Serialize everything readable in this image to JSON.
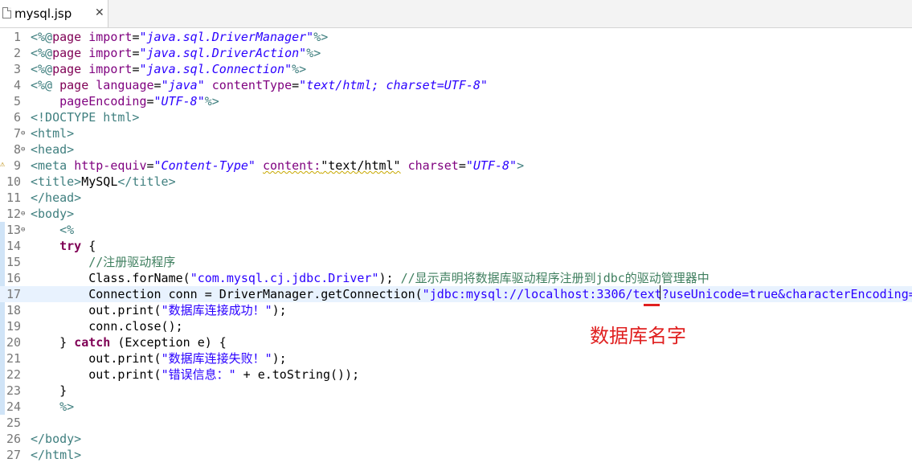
{
  "tab": {
    "label": "mysql.jsp",
    "close": "✕",
    "icon": "jsp-file-icon"
  },
  "annotation": {
    "text": "数据库名字",
    "color": "#e02020"
  },
  "colors": {
    "tag": "#3f7f7f",
    "keyword": "#7f0055",
    "string": "#2a00ff",
    "comment": "#3f7f5f",
    "attribute": "#7f007f",
    "current_line": "#e8f2fe"
  },
  "lines": [
    {
      "n": "1",
      "fold": false,
      "warn": false,
      "current": false,
      "tokens": [
        [
          "tag",
          "<%@"
        ],
        [
          "dir",
          "page"
        ],
        [
          "plain",
          " "
        ],
        [
          "attr",
          "import"
        ],
        [
          "plain",
          "="
        ],
        [
          "str",
          "\"java.sql.DriverManager\""
        ],
        [
          "tag",
          "%>"
        ]
      ]
    },
    {
      "n": "2",
      "fold": false,
      "warn": false,
      "current": false,
      "tokens": [
        [
          "tag",
          "<%@"
        ],
        [
          "dir",
          "page"
        ],
        [
          "plain",
          " "
        ],
        [
          "attr",
          "import"
        ],
        [
          "plain",
          "="
        ],
        [
          "str",
          "\"java.sql.DriverAction\""
        ],
        [
          "tag",
          "%>"
        ]
      ]
    },
    {
      "n": "3",
      "fold": false,
      "warn": false,
      "current": false,
      "tokens": [
        [
          "tag",
          "<%@"
        ],
        [
          "dir",
          "page"
        ],
        [
          "plain",
          " "
        ],
        [
          "attr",
          "import"
        ],
        [
          "plain",
          "="
        ],
        [
          "str",
          "\"java.sql.Connection\""
        ],
        [
          "tag",
          "%>"
        ]
      ]
    },
    {
      "n": "4",
      "fold": false,
      "warn": false,
      "current": false,
      "tokens": [
        [
          "tag",
          "<%@"
        ],
        [
          "plain",
          " "
        ],
        [
          "dir",
          "page"
        ],
        [
          "plain",
          " "
        ],
        [
          "attr",
          "language"
        ],
        [
          "plain",
          "="
        ],
        [
          "str",
          "\"java\""
        ],
        [
          "plain",
          " "
        ],
        [
          "attr",
          "contentType"
        ],
        [
          "plain",
          "="
        ],
        [
          "str",
          "\"text/html; charset=UTF-8\""
        ]
      ]
    },
    {
      "n": "5",
      "fold": false,
      "warn": false,
      "current": false,
      "tokens": [
        [
          "plain",
          "    "
        ],
        [
          "attr",
          "pageEncoding"
        ],
        [
          "plain",
          "="
        ],
        [
          "str",
          "\"UTF-8\""
        ],
        [
          "tag",
          "%>"
        ]
      ]
    },
    {
      "n": "6",
      "fold": false,
      "warn": false,
      "current": false,
      "tokens": [
        [
          "tag",
          "<!DOCTYPE html>"
        ]
      ]
    },
    {
      "n": "7",
      "fold": true,
      "warn": false,
      "current": false,
      "tokens": [
        [
          "tag",
          "<html>"
        ]
      ]
    },
    {
      "n": "8",
      "fold": true,
      "warn": false,
      "current": false,
      "tokens": [
        [
          "tag",
          "<head>"
        ]
      ]
    },
    {
      "n": "9",
      "fold": false,
      "warn": true,
      "current": false,
      "tokens": [
        [
          "tag",
          "<meta"
        ],
        [
          "plain",
          " "
        ],
        [
          "attr",
          "http-equiv"
        ],
        [
          "plain",
          "="
        ],
        [
          "str",
          "\"Content-Type\""
        ],
        [
          "plain",
          " "
        ],
        [
          "attrsq",
          "content:"
        ],
        [
          "plainsq",
          "\"text/html\""
        ],
        [
          "plain",
          " "
        ],
        [
          "attr",
          "charset"
        ],
        [
          "plain",
          "="
        ],
        [
          "str",
          "\"UTF-8\""
        ],
        [
          "tag",
          ">"
        ]
      ]
    },
    {
      "n": "10",
      "fold": false,
      "warn": false,
      "current": false,
      "tokens": [
        [
          "tag",
          "<title>"
        ],
        [
          "plain",
          "MySQL"
        ],
        [
          "tag",
          "</title>"
        ]
      ]
    },
    {
      "n": "11",
      "fold": false,
      "warn": false,
      "current": false,
      "tokens": [
        [
          "tag",
          "</head>"
        ]
      ]
    },
    {
      "n": "12",
      "fold": true,
      "warn": false,
      "current": false,
      "tokens": [
        [
          "tag",
          "<body>"
        ]
      ]
    },
    {
      "n": "13",
      "fold": true,
      "warn": false,
      "current": false,
      "tokens": [
        [
          "plain",
          "    "
        ],
        [
          "tag",
          "<%"
        ]
      ]
    },
    {
      "n": "14",
      "fold": false,
      "warn": false,
      "current": false,
      "tokens": [
        [
          "plain",
          "    "
        ],
        [
          "kw",
          "try"
        ],
        [
          "plain",
          " {"
        ]
      ]
    },
    {
      "n": "15",
      "fold": false,
      "warn": false,
      "current": false,
      "tokens": [
        [
          "plain",
          "        "
        ],
        [
          "cmt",
          "//注册驱动程序"
        ]
      ]
    },
    {
      "n": "16",
      "fold": false,
      "warn": false,
      "current": false,
      "tokens": [
        [
          "plain",
          "        Class.forName("
        ],
        [
          "jstr",
          "\"com.mysql.cj.jdbc.Driver\""
        ],
        [
          "plain",
          "); "
        ],
        [
          "cmt",
          "//显示声明将数据库驱动程序注册到jdbc的驱动管理器中"
        ]
      ]
    },
    {
      "n": "17",
      "fold": false,
      "warn": false,
      "current": true,
      "tokens": [
        [
          "plain",
          "        Connection conn = DriverManager.getConnection("
        ],
        [
          "jstr",
          "\"jdbc:mysql://localhost:3306/text?useUnicode=true&characterEncoding="
        ]
      ]
    },
    {
      "n": "18",
      "fold": false,
      "warn": false,
      "current": false,
      "tokens": [
        [
          "plain",
          "        out.print("
        ],
        [
          "jstr",
          "\"数据库连接成功！\""
        ],
        [
          "plain",
          ");"
        ]
      ]
    },
    {
      "n": "19",
      "fold": false,
      "warn": false,
      "current": false,
      "tokens": [
        [
          "plain",
          "        conn.close();"
        ]
      ]
    },
    {
      "n": "20",
      "fold": false,
      "warn": false,
      "current": false,
      "tokens": [
        [
          "plain",
          "    } "
        ],
        [
          "kw",
          "catch"
        ],
        [
          "plain",
          " (Exception e) {"
        ]
      ]
    },
    {
      "n": "21",
      "fold": false,
      "warn": false,
      "current": false,
      "tokens": [
        [
          "plain",
          "        out.print("
        ],
        [
          "jstr",
          "\"数据库连接失败！\""
        ],
        [
          "plain",
          ");"
        ]
      ]
    },
    {
      "n": "22",
      "fold": false,
      "warn": false,
      "current": false,
      "tokens": [
        [
          "plain",
          "        out.print("
        ],
        [
          "jstr",
          "\"错误信息：\""
        ],
        [
          "plain",
          " + e.toString());"
        ]
      ]
    },
    {
      "n": "23",
      "fold": false,
      "warn": false,
      "current": false,
      "tokens": [
        [
          "plain",
          "    }"
        ]
      ]
    },
    {
      "n": "24",
      "fold": false,
      "warn": false,
      "current": false,
      "tokens": [
        [
          "plain",
          "    "
        ],
        [
          "tag",
          "%>"
        ]
      ]
    },
    {
      "n": "25",
      "fold": false,
      "warn": false,
      "current": false,
      "tokens": []
    },
    {
      "n": "26",
      "fold": false,
      "warn": false,
      "current": false,
      "tokens": [
        [
          "tag",
          "</body>"
        ]
      ]
    },
    {
      "n": "27",
      "fold": false,
      "warn": false,
      "current": false,
      "tokens": [
        [
          "tag",
          "</html>"
        ]
      ]
    }
  ]
}
